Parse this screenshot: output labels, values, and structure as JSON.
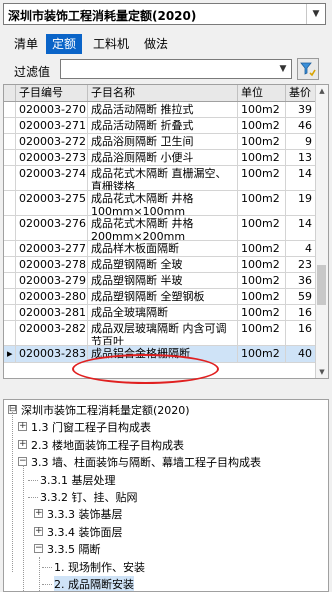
{
  "quota_select": {
    "value": "深圳市装饰工程消耗量定额(2020)"
  },
  "tabs": [
    {
      "label": "清单"
    },
    {
      "label": "定额"
    },
    {
      "label": "工料机"
    },
    {
      "label": "做法"
    }
  ],
  "filter": {
    "label": "过滤值",
    "value": ""
  },
  "grid": {
    "columns": [
      "子目编号",
      "子目名称",
      "单位",
      "基价"
    ],
    "rows": [
      {
        "code": "020003-270",
        "name": "成品活动隔断 推拉式",
        "unit": "100m2",
        "price": "39"
      },
      {
        "code": "020003-271",
        "name": "成品活动隔断 折叠式",
        "unit": "100m2",
        "price": "46"
      },
      {
        "code": "020003-272",
        "name": "成品浴厕隔断 卫生间",
        "unit": "100m2",
        "price": "9"
      },
      {
        "code": "020003-273",
        "name": "成品浴厕隔断 小便斗",
        "unit": "100m2",
        "price": "13"
      },
      {
        "code": "020003-274",
        "name": "成品花式木隔断 直栅漏空、直栅镂格",
        "unit": "100m2",
        "price": "14"
      },
      {
        "code": "020003-275",
        "name": "成品花式木隔断 井格100mm×100mm",
        "unit": "100m2",
        "price": "19"
      },
      {
        "code": "020003-276",
        "name": "成品花式木隔断 井格200mm×200mm",
        "unit": "100m2",
        "price": "14"
      },
      {
        "code": "020003-277",
        "name": "成品样木板面隔断",
        "unit": "100m2",
        "price": "4"
      },
      {
        "code": "020003-278",
        "name": "成品塑钢隔断 全玻",
        "unit": "100m2",
        "price": "23"
      },
      {
        "code": "020003-279",
        "name": "成品塑钢隔断 半玻",
        "unit": "100m2",
        "price": "36"
      },
      {
        "code": "020003-280",
        "name": "成品塑钢隔断 全塑钢板",
        "unit": "100m2",
        "price": "59"
      },
      {
        "code": "020003-281",
        "name": "成品全玻璃隔断",
        "unit": "100m2",
        "price": "16"
      },
      {
        "code": "020003-282",
        "name": "成品双层玻璃隔断 内含可调节百叶",
        "unit": "100m2",
        "price": "16"
      },
      {
        "code": "020003-283",
        "name": "成品铝合金格栅隔断",
        "unit": "100m2",
        "price": "40"
      }
    ]
  },
  "tree": {
    "nodes": [
      {
        "label": "深圳市装饰工程消耗量定额(2020)",
        "expander": "⊟"
      },
      {
        "label": "1.3 门窗工程子目构成表",
        "expander": "+"
      },
      {
        "label": "2.3 楼地面装饰工程子目构成表",
        "expander": "+"
      },
      {
        "label": "3.3 墙、柱面装饰与隔断、幕墙工程子目构成表",
        "expander": "−"
      },
      {
        "label": "3.3.1 基层处理",
        "expander": ""
      },
      {
        "label": "3.3.2 钉、挂、贴网",
        "expander": ""
      },
      {
        "label": "3.3.3 装饰基层",
        "expander": "+"
      },
      {
        "label": "3.3.4 装饰面层",
        "expander": "+"
      },
      {
        "label": "3.3.5 隔断",
        "expander": "−"
      },
      {
        "label": "1. 现场制作、安装",
        "expander": ""
      },
      {
        "label": "2. 成品隔断安装",
        "expander": ""
      },
      {
        "label": "3.3.6 隔墙",
        "expander": "+"
      }
    ]
  },
  "colors": {
    "accent": "#0a64c8",
    "selection": "#cfe3f7",
    "annotation": "#e02020"
  }
}
